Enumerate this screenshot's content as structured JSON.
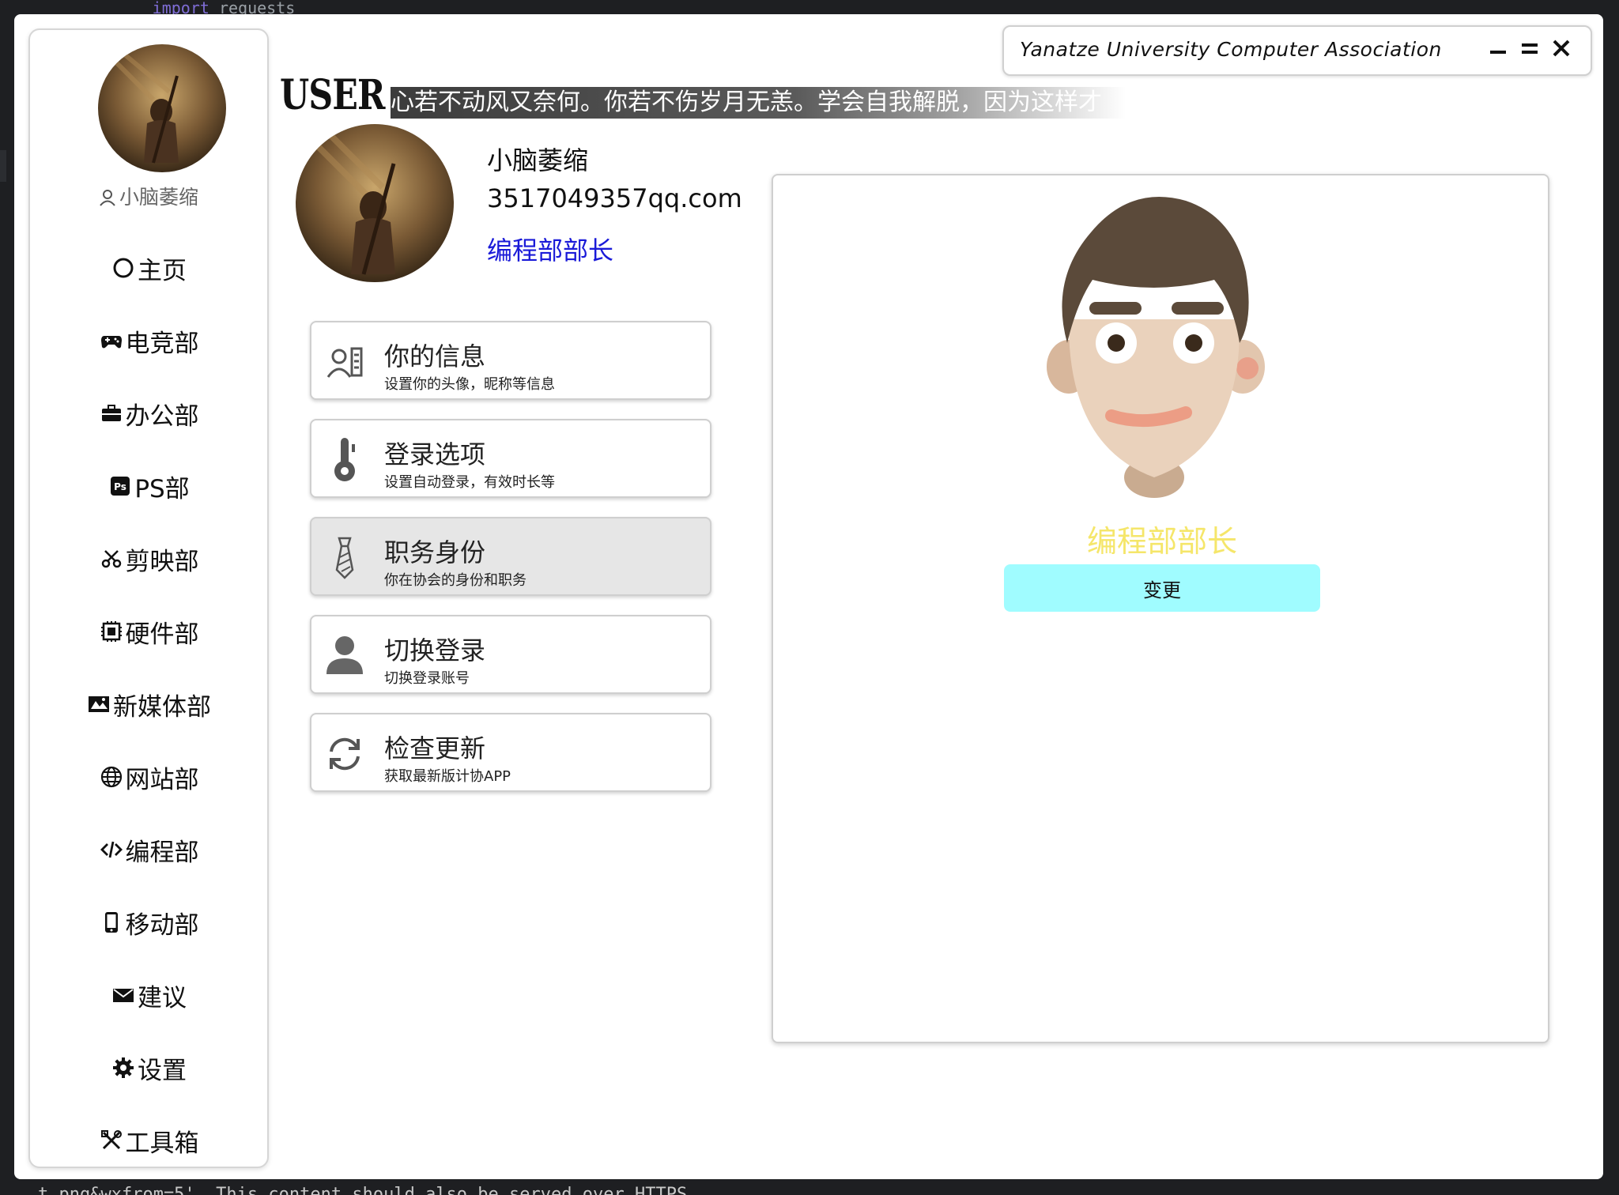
{
  "background": {
    "top_code_keyword": "import",
    "top_code_text": "requests",
    "bottom_console_text": "t.png&wxfrom=5'. This content should also be served over HTTPS."
  },
  "window": {
    "title": "Yanatze University Computer Association",
    "minimize_icon": "minimize-icon",
    "maximize_icon": "maximize-icon",
    "close_icon": "close-icon"
  },
  "sidebar": {
    "username": "小脑萎缩",
    "items": [
      {
        "label": "主页",
        "icon": "circle-icon"
      },
      {
        "label": "电竞部",
        "icon": "gamepad-icon"
      },
      {
        "label": "办公部",
        "icon": "briefcase-icon"
      },
      {
        "label": "PS部",
        "icon": "photoshop-icon"
      },
      {
        "label": "剪映部",
        "icon": "scissors-icon"
      },
      {
        "label": "硬件部",
        "icon": "chip-icon"
      },
      {
        "label": "新媒体部",
        "icon": "media-icon"
      },
      {
        "label": "网站部",
        "icon": "globe-icon"
      },
      {
        "label": "编程部",
        "icon": "code-icon"
      },
      {
        "label": "移动部",
        "icon": "phone-icon"
      },
      {
        "label": "建议",
        "icon": "mail-icon"
      },
      {
        "label": "设置",
        "icon": "gear-icon"
      },
      {
        "label": "工具箱",
        "icon": "tools-icon"
      }
    ]
  },
  "header": {
    "heading": "USER",
    "marquee": "心若不动风又奈何。你若不伤岁月无恙。学会自我解脱，因为这样才"
  },
  "profile": {
    "name": "小脑萎缩",
    "email": "3517049357qq.com",
    "role": "编程部部长"
  },
  "menu": [
    {
      "title": "你的信息",
      "subtitle": "设置你的头像，昵称等信息",
      "icon": "contact-card-icon",
      "active": false
    },
    {
      "title": "登录选项",
      "subtitle": "设置自动登录，有效时长等",
      "icon": "thermometer-icon",
      "active": false
    },
    {
      "title": "职务身份",
      "subtitle": "你在协会的身份和职务",
      "icon": "tie-icon",
      "active": true
    },
    {
      "title": "切换登录",
      "subtitle": "切换登录账号",
      "icon": "person-icon",
      "active": false
    },
    {
      "title": "检查更新",
      "subtitle": "获取最新版计协APP",
      "icon": "refresh-icon",
      "active": false
    }
  ],
  "panel": {
    "role": "编程部部长",
    "change_button": "变更",
    "role_color": "#f5e66a",
    "button_color": "#a0fcff"
  }
}
